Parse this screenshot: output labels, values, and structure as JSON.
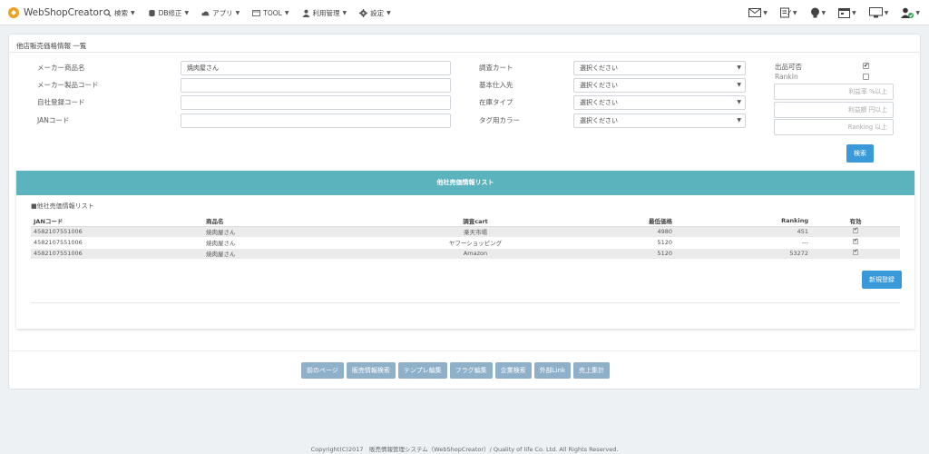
{
  "app": {
    "brand": "WebShopCreator"
  },
  "nav": {
    "menu": [
      {
        "label": "検索",
        "icon": "search-icon"
      },
      {
        "label": "DB修正",
        "icon": "db-icon"
      },
      {
        "label": "アプリ",
        "icon": "cloud-icon"
      },
      {
        "label": "TOOL",
        "icon": "tool-icon"
      },
      {
        "label": "利用管理",
        "icon": "user-icon"
      },
      {
        "label": "設定",
        "icon": "gear-icon"
      }
    ],
    "right_icons": [
      "mail-icon",
      "edit-icon",
      "bulb-icon",
      "calendar-icon",
      "monitor-icon",
      "user-check-icon"
    ]
  },
  "page": {
    "title": "他店販売価格情報 一覧"
  },
  "form": {
    "maker_name_label": "メーカー商品名",
    "maker_name_value": "焼肉屋さん",
    "maker_code_label": "メーカー製品コード",
    "own_code_label": "自社登録コード",
    "jan_label": "JANコード",
    "survey_cart_label": "調査カート",
    "base_supplier_label": "基本仕入先",
    "stock_type_label": "在庫タイプ",
    "tag_color_label": "タグ用カラー",
    "select_placeholder": "選択ください",
    "listing_ok_label": "出品可否",
    "rankin_label": "RankIn",
    "profit_rate_placeholder": "利益率 %以上",
    "profit_amount_placeholder": "利益額 円以上",
    "ranking_placeholder": "Ranking 以上",
    "search_button": "検索"
  },
  "list": {
    "header": "他社売価情報リスト",
    "subheader": "■他社売価情報リスト",
    "columns": [
      "JANコード",
      "商品名",
      "調査cart",
      "最低価格",
      "Ranking",
      "有効"
    ],
    "rows": [
      {
        "jan": "4582107551006",
        "name": "焼肉屋さん",
        "cart": "楽天市場",
        "price": "4980",
        "ranking": "451",
        "valid": true
      },
      {
        "jan": "4582107551006",
        "name": "焼肉屋さん",
        "cart": "ヤフーショッピング",
        "price": "5120",
        "ranking": "---",
        "valid": true
      },
      {
        "jan": "4582107551006",
        "name": "焼肉屋さん",
        "cart": "Amazon",
        "price": "5120",
        "ranking": "53272",
        "valid": true
      }
    ],
    "new_button": "新規登録"
  },
  "bottom_buttons": [
    "前のページ",
    "販売情報検索",
    "テンプレ編集",
    "フラグ編集",
    "企業検索",
    "外部Link",
    "売上集計"
  ],
  "footer": "Copyright(C)2017　販売情報管理システム（WebShopCreator）/ Quality of life Co. Ltd. All Rights Reserved.",
  "colors": {
    "accent": "#3a9ad9",
    "card_header": "#5bb3be",
    "gray_button": "#8fb0c9"
  }
}
